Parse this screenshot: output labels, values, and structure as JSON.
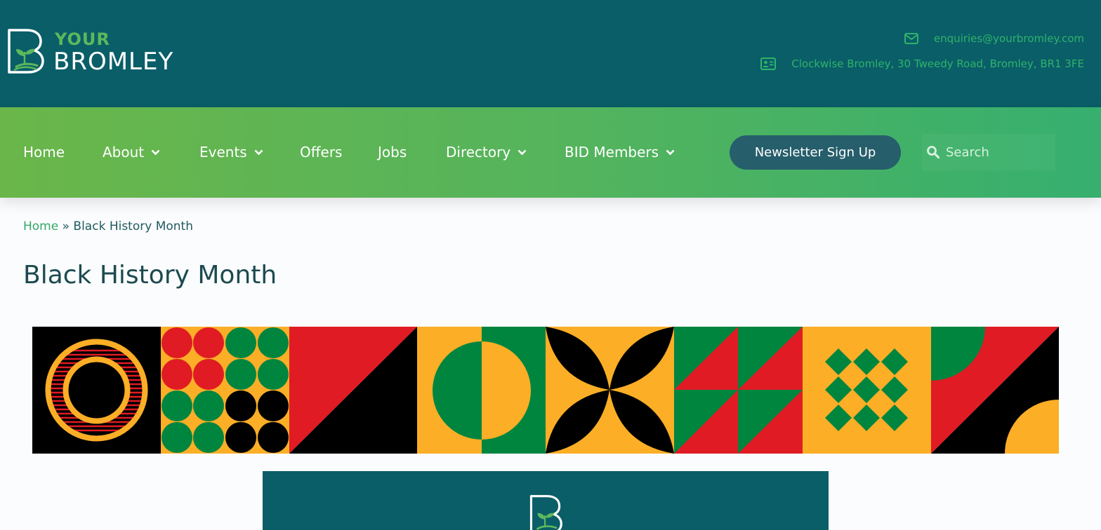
{
  "header": {
    "logo_line1": "YOUR",
    "logo_line2": "BROMLEY",
    "email": "enquiries@yourbromley.com",
    "address": "Clockwise Bromley, 30 Tweedy Road, Bromley, BR1 3FE",
    "icons": {
      "email": "envelope-icon",
      "address": "address-card-icon"
    }
  },
  "nav": {
    "items": [
      {
        "label": "Home",
        "has_dropdown": false
      },
      {
        "label": "About",
        "has_dropdown": true
      },
      {
        "label": "Events",
        "has_dropdown": true
      },
      {
        "label": "Offers",
        "has_dropdown": false
      },
      {
        "label": "Jobs",
        "has_dropdown": false
      },
      {
        "label": "Directory",
        "has_dropdown": true
      },
      {
        "label": "BID Members",
        "has_dropdown": true
      }
    ],
    "newsletter_button": "Newsletter Sign Up",
    "search_placeholder": "Search"
  },
  "breadcrumb": {
    "home": "Home",
    "separator": "»",
    "current": "Black History Month"
  },
  "page": {
    "title": "Black History Month"
  },
  "colors": {
    "header_bg": "#0a5e68",
    "nav_gradient_start": "#6ab64a",
    "nav_gradient_end": "#36af6f",
    "accent_green": "#33a86a",
    "button_bg": "#265e6b",
    "pattern_black": "#000000",
    "pattern_red": "#e01b24",
    "pattern_green": "#00853f",
    "pattern_gold": "#fbae26"
  }
}
